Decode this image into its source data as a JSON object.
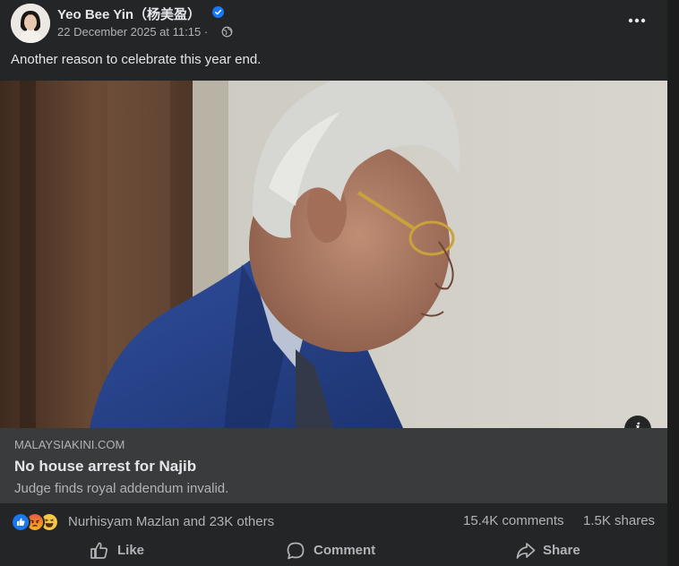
{
  "post": {
    "author": "Yeo Bee Yin（杨美盈）",
    "timestamp": "22 December 2025 at 11:15",
    "separator": "·",
    "caption": "Another reason to celebrate this year end.",
    "photo_icon": "person-photo",
    "link": {
      "domain": "MALAYSIAKINI.COM",
      "title": "No house arrest for Najib",
      "description": "Judge finds royal addendum invalid."
    },
    "reactions": {
      "icons": [
        "like-reaction-icon",
        "angry-reaction-icon",
        "haha-reaction-icon"
      ],
      "summary": "Nurhisyam Mazlan and 23K others"
    },
    "counts": {
      "comments": "15.4K comments",
      "shares": "1.5K shares"
    },
    "actions": {
      "like": "Like",
      "comment": "Comment",
      "share": "Share"
    }
  },
  "colors": {
    "background": "#242526",
    "card": "#3a3b3c",
    "text_primary": "#e4e6eb",
    "text_secondary": "#b0b3b8",
    "verified": "#1877f2"
  }
}
